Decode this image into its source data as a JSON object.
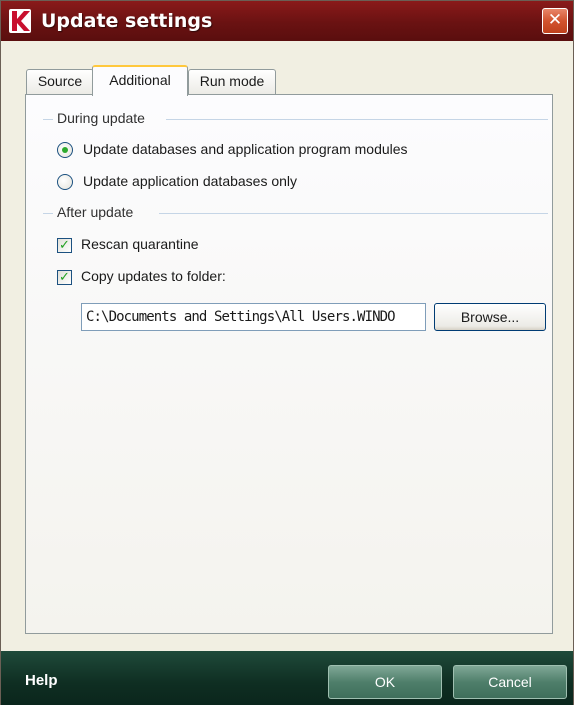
{
  "window": {
    "title": "Update settings",
    "close_glyph": "✕",
    "icon": "kaspersky-k-logo-icon"
  },
  "tabs": [
    {
      "label": "Source",
      "active": false
    },
    {
      "label": "Additional",
      "active": true
    },
    {
      "label": "Run mode",
      "active": false
    }
  ],
  "during_update": {
    "title": "During update",
    "options": [
      {
        "label": "Update databases and application program modules",
        "checked": true
      },
      {
        "label": "Update application databases only",
        "checked": false
      }
    ]
  },
  "after_update": {
    "title": "After update",
    "rescan": {
      "label": "Rescan quarantine",
      "checked": true
    },
    "copy": {
      "label": "Copy updates to folder:",
      "checked": true
    },
    "folder_path": "C:\\Documents and Settings\\All Users.WINDO",
    "browse_label": "Browse..."
  },
  "footer": {
    "help_label": "Help",
    "ok_label": "OK",
    "cancel_label": "Cancel"
  },
  "colors": {
    "titlebar": "#6a1212",
    "footer": "#0f2e22",
    "check_mark": "#21a121",
    "radio_dot": "#2eaa2e"
  }
}
